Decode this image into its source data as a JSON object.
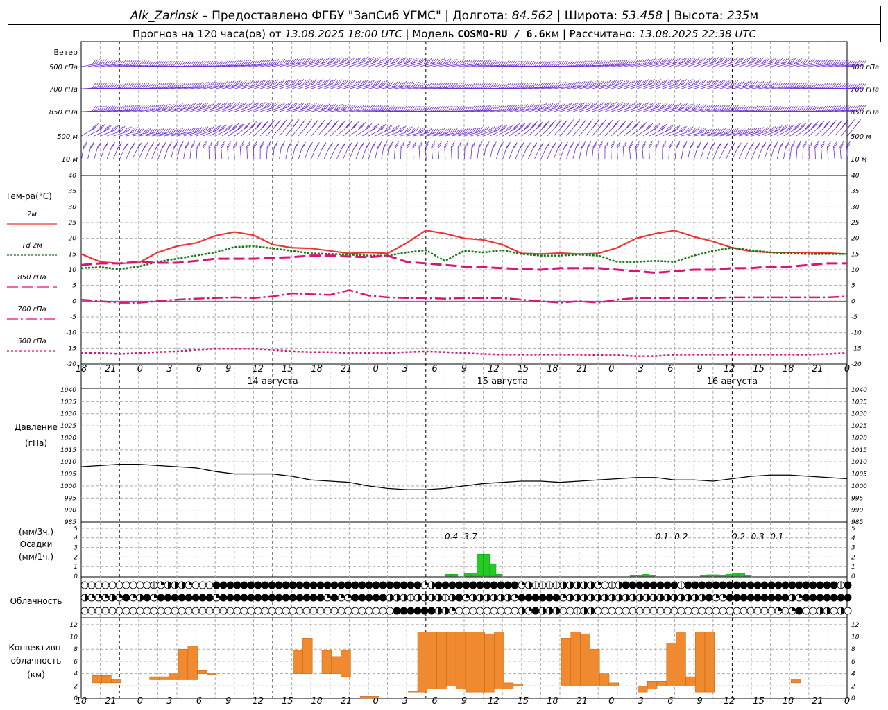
{
  "header": {
    "station": "Alk_Zarinsk",
    "provider": " – Предоставлено ФГБУ \"ЗапСиб УГМС\" | Долгота: ",
    "lon": "84.562",
    "lat_label": " | Широта: ",
    "lat": "53.458",
    "alt_label": " | Высота: ",
    "alt": "235",
    "alt_unit": "м",
    "forecast_label": "Прогноз на 120 часа(ов) от ",
    "forecast_time": "13.08.2025 18:00 UTC",
    "model_label": "  | Модель ",
    "model": "COSMO-RU / 6.6",
    "model_unit": "км",
    "calc_label": " | Рассчитано: ",
    "calc_time": "13.08.2025 22:38 UTC"
  },
  "wind": {
    "title": "Ветер",
    "levels": [
      "500 гПа",
      "700 гПа",
      "850 гПа",
      "500 м",
      "10  м"
    ]
  },
  "temp": {
    "title": "Тем-ра(°С)",
    "legend": [
      {
        "label": "2м",
        "color": "#ee3333"
      },
      {
        "label": "Td  2м",
        "color": "#117711"
      },
      {
        "label": "850 гПа",
        "color": "#dd1177"
      },
      {
        "label": "700 гПа",
        "color": "#dd1177"
      },
      {
        "label": "500 гПа",
        "color": "#dd1177"
      }
    ]
  },
  "time_axis": {
    "hours": [
      "18",
      "21",
      "0",
      "3",
      "6",
      "9",
      "12",
      "15",
      "18",
      "21",
      "0",
      "3",
      "6",
      "9",
      "12",
      "15",
      "18",
      "21",
      "0",
      "3",
      "6",
      "9",
      "12",
      "15",
      "18",
      "21",
      "0"
    ],
    "dates": [
      "14 августа",
      "15 августа",
      "16 августа"
    ]
  },
  "pressure": {
    "title1": "Давление",
    "title2": "(гПа)"
  },
  "precip": {
    "title1": "(мм/3ч.)",
    "title2": "Осадки",
    "title3": "(мм/1ч.)"
  },
  "cloud": {
    "title": "Облачность"
  },
  "conv": {
    "title1": "Конвективн.",
    "title2": "облачность",
    "title3": "(км)"
  },
  "chart_data": [
    {
      "type": "line",
      "title": "Тем-ра(°С)",
      "ylim": [
        -20,
        40
      ],
      "x_hours": [
        0,
        3,
        6,
        9,
        12,
        15,
        18,
        21,
        24,
        27,
        30,
        33,
        36,
        39,
        42,
        45,
        48,
        51,
        54,
        57,
        60,
        63,
        66,
        69,
        72,
        75,
        78,
        81,
        84,
        87,
        90,
        93,
        96,
        99,
        102,
        105,
        108,
        111,
        114,
        117,
        120
      ],
      "series": [
        {
          "name": "2м",
          "color": "#ee3333",
          "values": [
            15,
            12.5,
            12,
            12.2,
            15.5,
            17.5,
            18.5,
            20.8,
            22,
            21,
            18,
            17,
            16.8,
            16,
            15.2,
            15.5,
            15.2,
            18.5,
            22.5,
            21.5,
            20,
            19.5,
            18,
            15.2,
            15,
            15.3,
            15,
            15.2,
            17,
            20,
            21.5,
            22.5,
            20.5,
            19,
            17,
            15.8,
            15.5,
            15.5,
            15.5,
            15.3,
            15
          ]
        },
        {
          "name": "Td  2м",
          "color": "#117711",
          "values": [
            10.5,
            10.8,
            10.2,
            11,
            12.5,
            13.5,
            14.5,
            15.5,
            17.2,
            17.5,
            16.8,
            16,
            15.2,
            15,
            14.8,
            14.5,
            14.5,
            15.5,
            16.2,
            12.8,
            16,
            15.5,
            16.2,
            15,
            14.5,
            14.5,
            14.8,
            14.5,
            12.5,
            12.5,
            12.8,
            12.5,
            14.5,
            16,
            17,
            16.2,
            15.5,
            15.2,
            15,
            15,
            15
          ]
        },
        {
          "name": "850 гПа",
          "color": "#dd1177",
          "values": [
            11.5,
            12,
            12,
            12.5,
            12.2,
            12.2,
            12.8,
            13.5,
            13.5,
            13.5,
            13.8,
            14,
            14.5,
            14.5,
            14.2,
            14,
            14.5,
            12.5,
            12,
            11.5,
            11,
            10.8,
            10.5,
            10.2,
            10,
            10.5,
            10.5,
            10.5,
            10,
            9.5,
            9,
            9.5,
            10,
            10,
            10.5,
            10.5,
            11,
            11,
            11.5,
            12,
            12
          ]
        },
        {
          "name": "700 гПа",
          "color": "#dd1177",
          "values": [
            0.5,
            0,
            -0.5,
            -0.5,
            0,
            0.5,
            0.8,
            1,
            1.2,
            1,
            1.5,
            2.5,
            2.2,
            2,
            3.5,
            1.8,
            1.2,
            1,
            1,
            0.8,
            1,
            1,
            1,
            0.5,
            0,
            -0.5,
            0,
            -0.5,
            0.5,
            1,
            1,
            1,
            1,
            1,
            1.2,
            1.2,
            1.2,
            1.2,
            1.2,
            1.2,
            1.5
          ]
        },
        {
          "name": "500 гПа",
          "color": "#dd1177",
          "values": [
            -16.5,
            -16.5,
            -16.8,
            -16.5,
            -16.2,
            -16,
            -15.5,
            -15.2,
            -15.2,
            -15.2,
            -15.5,
            -16,
            -16.2,
            -16.2,
            -16.5,
            -16.5,
            -16.5,
            -16.2,
            -16,
            -16.2,
            -16.5,
            -16.8,
            -17,
            -17,
            -17,
            -17,
            -17,
            -17.2,
            -17.2,
            -17.5,
            -17.5,
            -17,
            -17,
            -17,
            -17,
            -17,
            -17,
            -17,
            -17,
            -16.8,
            -16.5
          ]
        }
      ]
    },
    {
      "type": "line",
      "title": "Давление",
      "ylabel": "(гПа)",
      "ylim": [
        985,
        1040
      ],
      "x_hours": [
        0,
        3,
        6,
        9,
        12,
        15,
        18,
        21,
        24,
        27,
        30,
        33,
        36,
        39,
        42,
        45,
        48,
        51,
        54,
        57,
        60,
        63,
        66,
        69,
        72,
        75,
        78,
        81,
        84,
        87,
        90,
        93,
        96,
        99,
        102,
        105,
        108,
        111,
        114,
        117,
        120
      ],
      "series": [
        {
          "name": "",
          "color": "#000000",
          "values": [
            1008,
            1008.5,
            1009,
            1009,
            1008.5,
            1008,
            1007.5,
            1006,
            1005,
            1005,
            1005,
            1004,
            1002.5,
            1002,
            1001.5,
            1000,
            999,
            998.5,
            998.5,
            999,
            1000,
            1001,
            1001.5,
            1002,
            1002,
            1001.5,
            1002,
            1002.5,
            1003,
            1003.5,
            1003.5,
            1002.5,
            1002.5,
            1002,
            1003,
            1004,
            1004.5,
            1004.5,
            1004,
            1003.5,
            1003
          ]
        }
      ]
    },
    {
      "type": "bar",
      "title": "Осадки",
      "ylim": [
        0,
        5
      ],
      "hourly_bars": [
        {
          "h": 57.5,
          "v": 0.2
        },
        {
          "h": 58.5,
          "v": 0.2
        },
        {
          "h": 60.5,
          "v": 0.3
        },
        {
          "h": 61.5,
          "v": 0.3
        },
        {
          "h": 62.5,
          "v": 2.3
        },
        {
          "h": 63.5,
          "v": 2.3
        },
        {
          "h": 64.5,
          "v": 1.3
        },
        {
          "h": 65.5,
          "v": 0.2
        },
        {
          "h": 86.5,
          "v": 0.1
        },
        {
          "h": 87.5,
          "v": 0.1
        },
        {
          "h": 88.5,
          "v": 0.2
        },
        {
          "h": 89.5,
          "v": 0.1
        },
        {
          "h": 97.5,
          "v": 0.1
        },
        {
          "h": 98.5,
          "v": 0.15
        },
        {
          "h": 99.5,
          "v": 0.15
        },
        {
          "h": 100.5,
          "v": 0.1
        },
        {
          "h": 101.5,
          "v": 0.2
        },
        {
          "h": 102.5,
          "v": 0.3
        },
        {
          "h": 103.5,
          "v": 0.3
        },
        {
          "h": 104.5,
          "v": 0.1
        }
      ],
      "labels": [
        {
          "h": 58,
          "text": "0.4"
        },
        {
          "h": 61,
          "text": "3.7"
        },
        {
          "h": 91,
          "text": "0.1"
        },
        {
          "h": 94,
          "text": "0.2"
        },
        {
          "h": 103,
          "text": "0.2"
        },
        {
          "h": 106,
          "text": "0.3"
        },
        {
          "h": 109,
          "text": "0.1"
        }
      ]
    },
    {
      "type": "bar",
      "title": "Конвективн. облачность (км)",
      "ylim": [
        0,
        13
      ],
      "bars": [
        {
          "h": 2,
          "b": 2.5,
          "t": 3.7
        },
        {
          "h": 3,
          "b": 2.5,
          "t": 3.7
        },
        {
          "h": 4,
          "b": 2.5,
          "t": 3
        },
        {
          "h": 8,
          "b": 3,
          "t": 3.5
        },
        {
          "h": 9,
          "b": 3,
          "t": 3.5
        },
        {
          "h": 10,
          "b": 3,
          "t": 4
        },
        {
          "h": 11,
          "b": 3,
          "t": 8
        },
        {
          "h": 12,
          "b": 3,
          "t": 8.5
        },
        {
          "h": 13,
          "b": 4,
          "t": 4.5
        },
        {
          "h": 14,
          "b": 4,
          "t": 4
        },
        {
          "h": 23,
          "b": 4,
          "t": 7.8
        },
        {
          "h": 24,
          "b": 4,
          "t": 9.8
        },
        {
          "h": 26,
          "b": 4,
          "t": 7.8
        },
        {
          "h": 27,
          "b": 4,
          "t": 6.8
        },
        {
          "h": 28,
          "b": 3.5,
          "t": 7.8
        },
        {
          "h": 30,
          "b": 0,
          "t": 0.3
        },
        {
          "h": 31,
          "b": 0,
          "t": 0.3
        },
        {
          "h": 35,
          "b": 1,
          "t": 1.2
        },
        {
          "h": 36,
          "b": 1,
          "t": 10.8
        },
        {
          "h": 37,
          "b": 1.5,
          "t": 10.8
        },
        {
          "h": 38,
          "b": 1.5,
          "t": 10.8
        },
        {
          "h": 39,
          "b": 2,
          "t": 10.8
        },
        {
          "h": 40,
          "b": 1.5,
          "t": 10.8
        },
        {
          "h": 41,
          "b": 1,
          "t": 10.8
        },
        {
          "h": 42,
          "b": 1,
          "t": 10.8
        },
        {
          "h": 43,
          "b": 1,
          "t": 10.5
        },
        {
          "h": 44,
          "b": 1.5,
          "t": 10.8
        },
        {
          "h": 45,
          "b": 1.5,
          "t": 2.5
        },
        {
          "h": 46,
          "b": 2,
          "t": 2.3
        },
        {
          "h": 51,
          "b": 2,
          "t": 9.8
        },
        {
          "h": 52,
          "b": 2,
          "t": 10.8
        },
        {
          "h": 53,
          "b": 2,
          "t": 10.5
        },
        {
          "h": 54,
          "b": 2,
          "t": 8
        },
        {
          "h": 55,
          "b": 2,
          "t": 4
        },
        {
          "h": 56,
          "b": 2,
          "t": 2.5
        },
        {
          "h": 59,
          "b": 1,
          "t": 2
        },
        {
          "h": 60,
          "b": 1.5,
          "t": 2.8
        },
        {
          "h": 61,
          "b": 2,
          "t": 2.8
        },
        {
          "h": 62,
          "b": 2,
          "t": 9
        },
        {
          "h": 63,
          "b": 2,
          "t": 10.8
        },
        {
          "h": 64,
          "b": 2,
          "t": 3.5
        },
        {
          "h": 65,
          "b": 1,
          "t": 10.8
        },
        {
          "h": 66,
          "b": 1,
          "t": 10.8
        },
        {
          "h": 75,
          "b": 2.5,
          "t": 3
        }
      ]
    }
  ],
  "cloud_rows": [
    "oooooooooocqhhhqoooffffffffffffffffffffffffffffffqhffffffffffffqhxxxxhhhhhqoxhffffffffxffffffffffffffffffffffxffffff",
    "hqqqhqfqhfqffffffffqfffffffffffffffqfqqfffffhhhxhhhhxhfqhhhhhhqffffffqhhhhhhhhhhhhhhhhhhhhfqqfffffffffhqffffffff",
    "oooooooooooooooooooooooooooooooooooooooooooooffffffhhqooooooooohqfhhhooxhhooooooooooooooooooooooooooqoqfoohhoho"
  ],
  "wind_rows": [
    "wind-500hpa-barbs",
    "wind-700hpa-barbs",
    "wind-850hpa-barbs",
    "wind-500m-barbs",
    "wind-10m-barbs"
  ]
}
